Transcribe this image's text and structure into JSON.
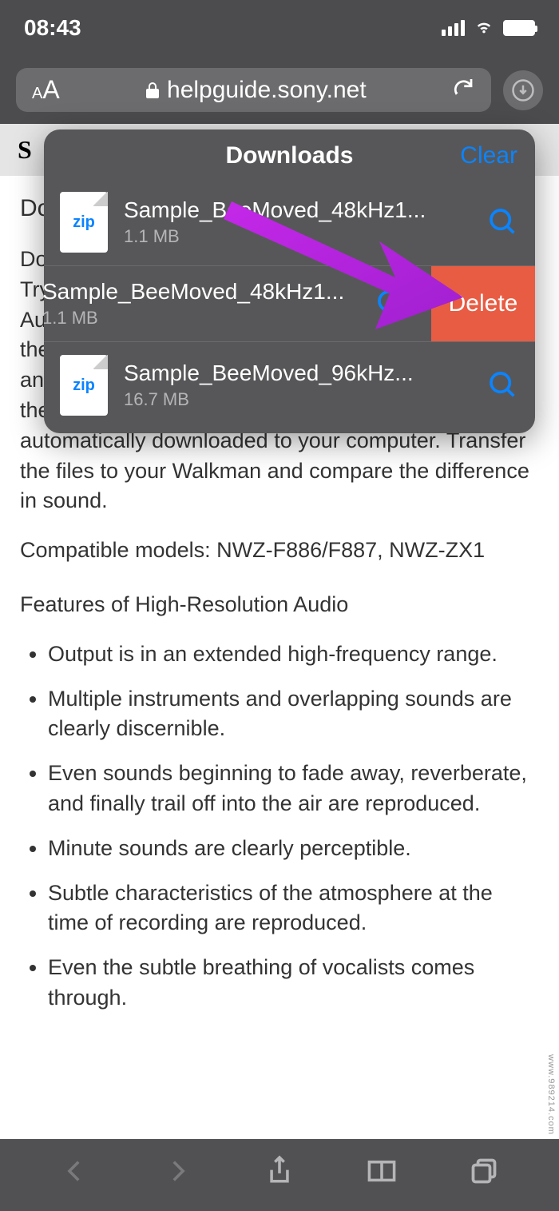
{
  "status": {
    "time": "08:43"
  },
  "nav": {
    "domain": "helpguide.sony.net"
  },
  "page": {
    "header_initial": "S",
    "truncated_title_1": "Do",
    "truncated_text_1": "Do",
    "truncated_text_2": "Try",
    "truncated_text_3": "Au",
    "truncated_text_4": "the",
    "truncated_text_5": "an",
    "truncated_text_6": "the",
    "para_tail": "automatically downloaded to your computer. Transfer the files to your Walkman and compare the difference in sound.",
    "compatible": "Compatible models: NWZ-F886/F887, NWZ-ZX1",
    "feature_title": "Features of High-Resolution Audio",
    "features": [
      "Output is in an extended high-frequency range.",
      "Multiple instruments and overlapping sounds are clearly discernible.",
      "Even sounds beginning to fade away, reverberate, and finally trail off into the air are reproduced.",
      "Minute sounds are clearly perceptible.",
      "Subtle characteristics of the atmosphere at the time of recording are reproduced.",
      "Even the subtle breathing of vocalists comes through."
    ]
  },
  "popover": {
    "title": "Downloads",
    "clear": "Clear",
    "delete": "Delete",
    "file_ext": "zip",
    "items": [
      {
        "name": "Sample_BeeMoved_48kHz1...",
        "size": "1.1 MB"
      },
      {
        "name": "Sample_BeeMoved_48kHz1...",
        "size": "1.1 MB"
      },
      {
        "name": "Sample_BeeMoved_96kHz...",
        "size": "16.7 MB"
      }
    ]
  },
  "watermark": "www.989214.com"
}
